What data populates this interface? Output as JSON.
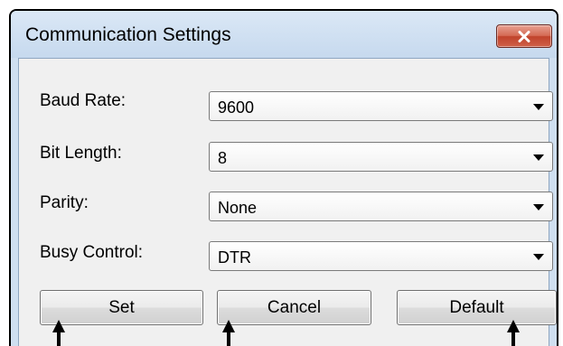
{
  "dialog": {
    "title": "Communication Settings",
    "close_icon": "close-x-icon"
  },
  "settings": [
    {
      "label": "Baud Rate:",
      "value": "9600"
    },
    {
      "label": "Bit Length:",
      "value": "8"
    },
    {
      "label": "Parity:",
      "value": "None"
    },
    {
      "label": "Busy Control:",
      "value": "DTR"
    }
  ],
  "buttons": {
    "set": "Set",
    "cancel": "Cancel",
    "default": "Default"
  },
  "annotation_icon": "up-arrow-pointer-icon",
  "colors": {
    "title_bar": "#c6d9ee",
    "client_area": "#f0f0f0",
    "close_button": "#c0432c"
  }
}
